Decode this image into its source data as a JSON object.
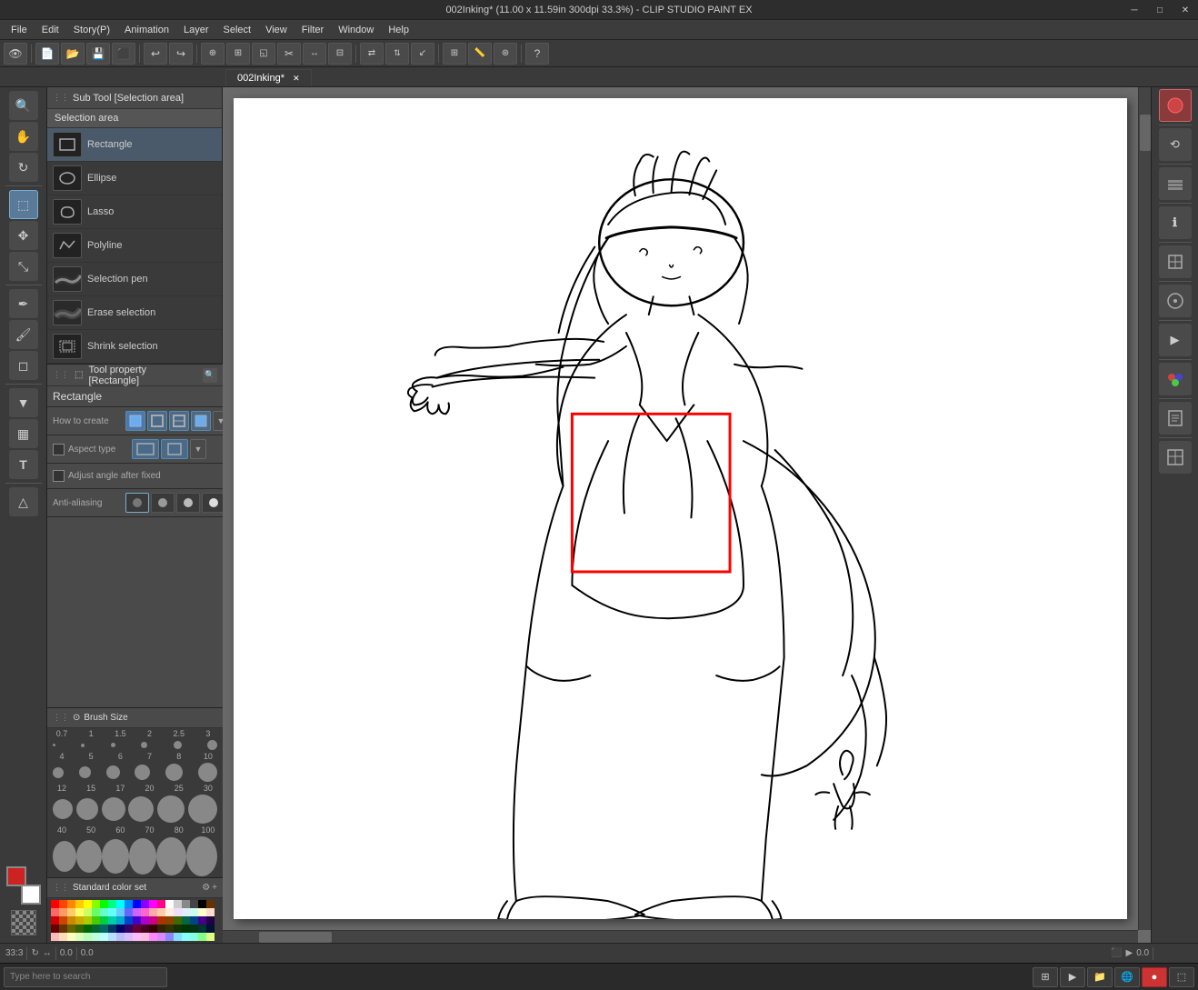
{
  "title": {
    "text": "002Inking* (11.00 x 11.59in 300dpi 33.3%)  -  CLIP STUDIO PAINT EX",
    "tab": "002Inking*"
  },
  "window_controls": {
    "minimize": "─",
    "maximize": "□",
    "close": "✕"
  },
  "menu": {
    "items": [
      "File",
      "Edit",
      "Story(P)",
      "Animation",
      "Layer",
      "Select",
      "View",
      "Filter",
      "Window",
      "Help"
    ]
  },
  "toolbar": {
    "buttons": [
      "👁",
      "✏",
      "📋",
      "💾",
      "⬛",
      "↩",
      "↪",
      "⊕",
      "↔",
      "✂",
      "⊞",
      "◱",
      "⟳",
      "?"
    ]
  },
  "second_toolbar": {
    "buttons": [
      "⊕",
      "⊞",
      "◱",
      "✂",
      "⟳",
      "◑",
      "⇄",
      "?"
    ]
  },
  "sub_tool_panel": {
    "header": "Sub Tool [Selection area]",
    "category": "Selection area",
    "items": [
      {
        "label": "Rectangle",
        "icon": "rect"
      },
      {
        "label": "Ellipse",
        "icon": "ellipse"
      },
      {
        "label": "Lasso",
        "icon": "lasso"
      },
      {
        "label": "Polyline",
        "icon": "polyline"
      },
      {
        "label": "Selection pen",
        "icon": "pen"
      },
      {
        "label": "Erase selection",
        "icon": "eraser"
      },
      {
        "label": "Shrink selection",
        "icon": "shrink"
      }
    ]
  },
  "tool_property": {
    "header": "Tool property [Rectangle]",
    "tool_name": "Rectangle",
    "rows": [
      {
        "label": "How to create",
        "type": "buttons"
      },
      {
        "label": "Aspect type",
        "type": "buttons_with_checkbox"
      },
      {
        "label": "Adjust angle after fixed",
        "type": "checkbox"
      },
      {
        "label": "Anti-aliasing",
        "type": "aa_buttons"
      }
    ],
    "how_to_create_options": [
      "filled",
      "stroke",
      "stroke2",
      "stroke3",
      "dropdown"
    ],
    "aspect_type_checkbox": false,
    "adjust_angle_checkbox": false
  },
  "brush_panel": {
    "header": "Brush Size",
    "size_values": [
      "0.7",
      "1",
      "1.5",
      "2",
      "2.5",
      "3",
      "4",
      "5",
      "6",
      "7",
      "8",
      "10",
      "12",
      "15",
      "17",
      "20",
      "25",
      "30",
      "40",
      "50",
      "60",
      "70",
      "80",
      "100"
    ],
    "dot_sizes": [
      3,
      4,
      5,
      6,
      7,
      8,
      9,
      10,
      12,
      14,
      16,
      18,
      20,
      22,
      24,
      26,
      28,
      30,
      32,
      34,
      36,
      38,
      40,
      42
    ]
  },
  "color_panel": {
    "header": "Standard color set",
    "label": "Standard color set",
    "swatches": [
      "#ff0000",
      "#ff4400",
      "#ff8800",
      "#ffcc00",
      "#ffff00",
      "#88ff00",
      "#00ff00",
      "#00ff88",
      "#00ffff",
      "#0088ff",
      "#0000ff",
      "#8800ff",
      "#ff00ff",
      "#ff0088",
      "#ffffff",
      "#cccccc",
      "#888888",
      "#444444",
      "#000000",
      "#663300",
      "#ff6666",
      "#ff9966",
      "#ffcc66",
      "#ffff66",
      "#ccff66",
      "#66ff66",
      "#66ffcc",
      "#66ffff",
      "#66ccff",
      "#6666ff",
      "#cc66ff",
      "#ff66cc",
      "#ffaaaa",
      "#ffccaa",
      "#ffeedd",
      "#eeddff",
      "#ddeeff",
      "#ccffee",
      "#ffffcc",
      "#ffddcc",
      "#cc0000",
      "#cc4400",
      "#cc8800",
      "#ccaa00",
      "#aacc00",
      "#44cc00",
      "#00cc44",
      "#00ccaa",
      "#00aacc",
      "#0044cc",
      "#4400cc",
      "#aa00cc",
      "#cc0088",
      "#aa3300",
      "#884400",
      "#446600",
      "#006644",
      "#004488",
      "#440088",
      "#220044",
      "#660000",
      "#663300",
      "#666600",
      "#336600",
      "#006600",
      "#006633",
      "#006666",
      "#003366",
      "#000066",
      "#330066",
      "#660033",
      "#440022",
      "#330000",
      "#332200",
      "#333300",
      "#113300",
      "#003300",
      "#003311",
      "#003333",
      "#001133",
      "#ffbbbb",
      "#ffddbb",
      "#ffffbb",
      "#ddffbb",
      "#bbffbb",
      "#bbffdd",
      "#bbffff",
      "#bbddff",
      "#bbbbff",
      "#ddbbff",
      "#ffbbff",
      "#ffbbdd",
      "#ff88ff",
      "#dd88ff",
      "#8888ff",
      "#88ddff",
      "#88ffff",
      "#88ffdd",
      "#88ff88",
      "#ddff88"
    ]
  },
  "colors": {
    "foreground": "#cc2222",
    "background": "#ffffff"
  },
  "status_bar": {
    "zoom": "33.3",
    "coordinates": "0.0",
    "position": "0.0",
    "canvas_info": "11.00 x 11.59in 300dpi"
  },
  "left_tools": [
    {
      "name": "zoom-tool",
      "icon": "🔍"
    },
    {
      "name": "hand-tool",
      "icon": "✋"
    },
    {
      "name": "rotate-tool",
      "icon": "↻"
    },
    {
      "name": "select-tool",
      "icon": "⬚",
      "active": true
    },
    {
      "name": "move-tool",
      "icon": "✥"
    },
    {
      "name": "transform-tool",
      "icon": "⤡"
    },
    {
      "name": "pen-tool",
      "icon": "✒"
    },
    {
      "name": "brush-tool",
      "icon": "🖌"
    },
    {
      "name": "eraser-tool",
      "icon": "◫"
    },
    {
      "name": "fill-tool",
      "icon": "▼"
    },
    {
      "name": "gradient-tool",
      "icon": "▦"
    },
    {
      "name": "text-tool",
      "icon": "T"
    },
    {
      "name": "figure-tool",
      "icon": "△"
    },
    {
      "name": "ruler-tool",
      "icon": "📐"
    }
  ],
  "right_tools": [
    {
      "name": "color-icon",
      "icon": "🎨",
      "active": true
    },
    {
      "name": "history-icon",
      "icon": "⟲"
    },
    {
      "name": "layers-icon",
      "icon": "⊞"
    },
    {
      "name": "properties-icon",
      "icon": "ℹ"
    },
    {
      "name": "material-icon",
      "icon": "◈"
    },
    {
      "name": "navigator-icon",
      "icon": "🧭"
    },
    {
      "name": "auto-action-icon",
      "icon": "▶"
    },
    {
      "name": "tool-palette-icon",
      "icon": "🎭"
    },
    {
      "name": "story-icon",
      "icon": "📖"
    },
    {
      "name": "comic-icon",
      "icon": "📄"
    }
  ]
}
